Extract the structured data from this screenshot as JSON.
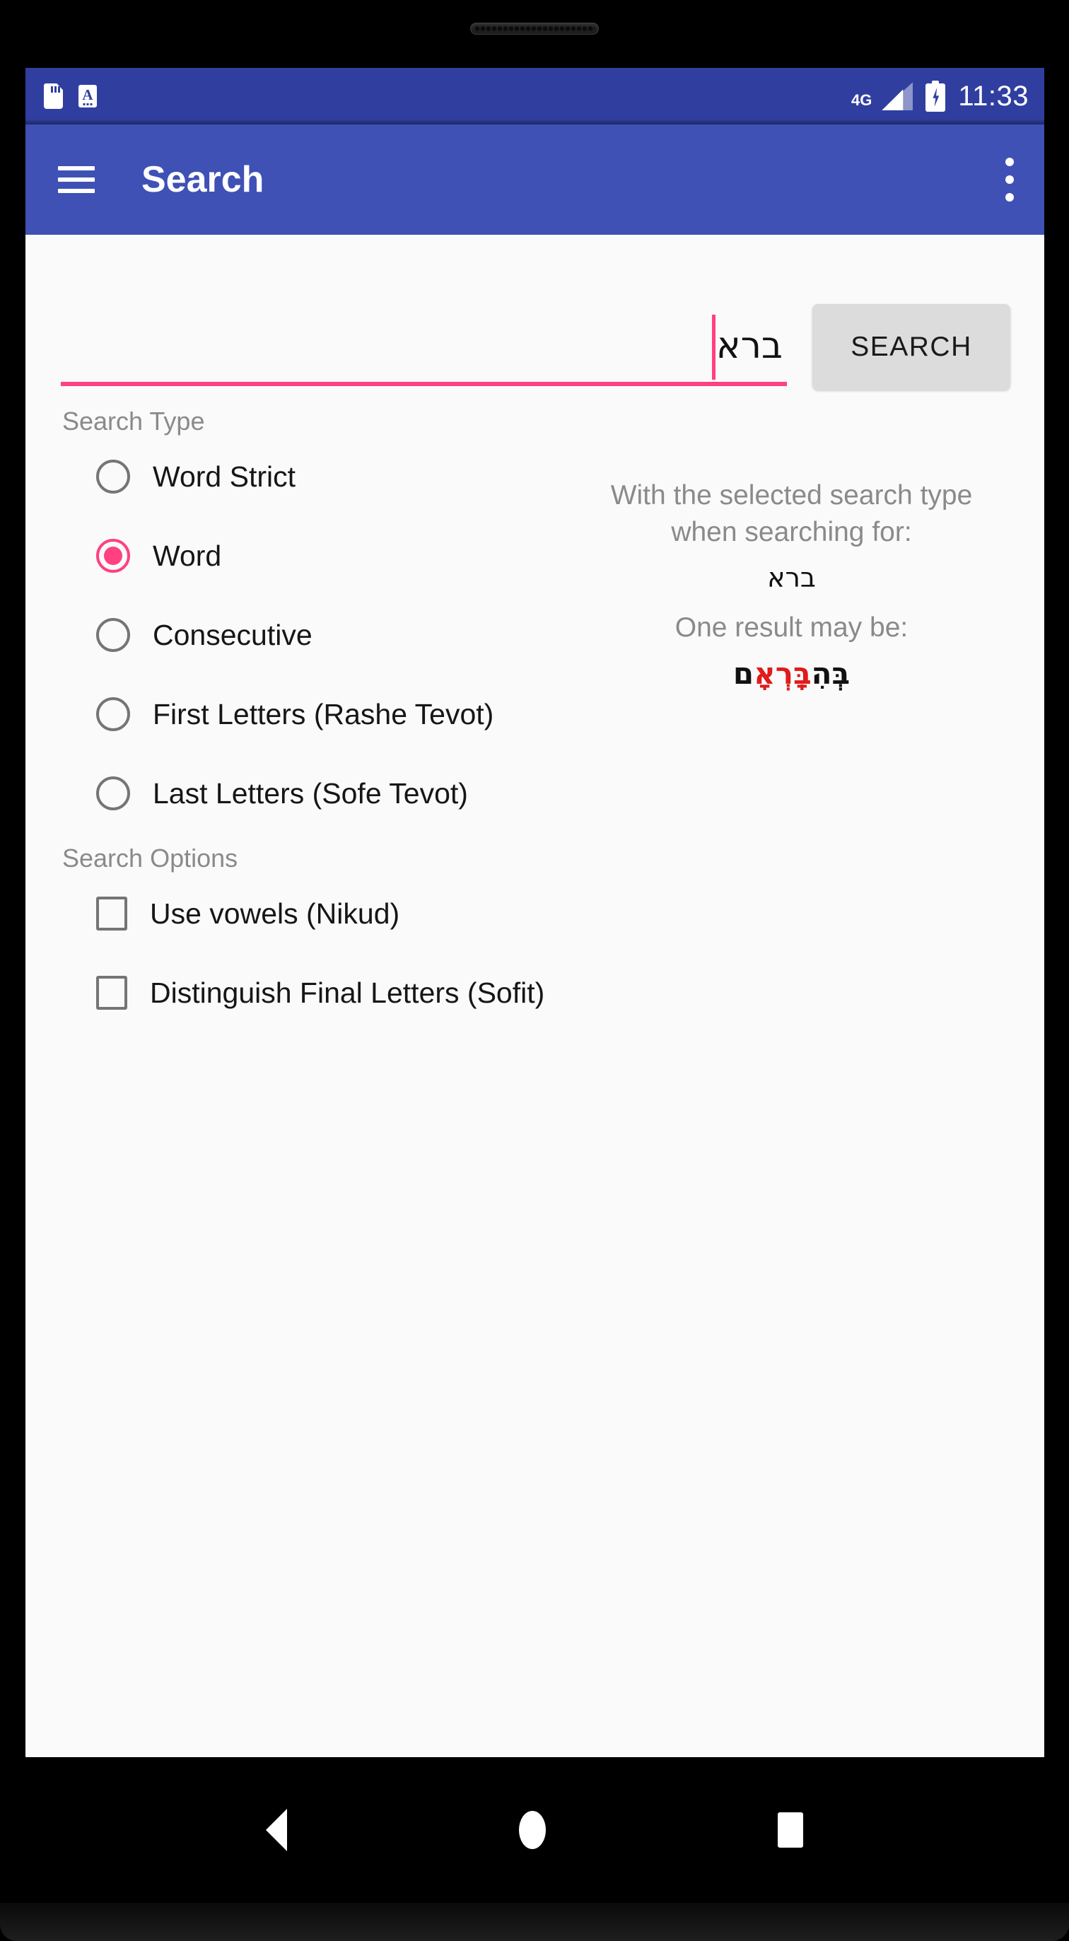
{
  "status_bar": {
    "icons": [
      "sdcard-icon",
      "keyboard-icon"
    ],
    "network_type": "4G",
    "clock": "11:33",
    "background_color": "#303F9F"
  },
  "app_bar": {
    "menu_icon": "hamburger-menu-icon",
    "title": "Search",
    "overflow_icon": "overflow-menu-icon",
    "background_color": "#3F51B5"
  },
  "search": {
    "input_value": "ברא",
    "placeholder": "",
    "button_label": "SEARCH",
    "underline_color": "#FF4081",
    "caret_color": "#FF4081"
  },
  "search_type": {
    "label": "Search Type",
    "selected": "Word",
    "options": [
      {
        "label": "Word Strict",
        "checked": false
      },
      {
        "label": "Word",
        "checked": true
      },
      {
        "label": "Consecutive",
        "checked": false
      },
      {
        "label": "First Letters (Rashe Tevot)",
        "checked": false
      },
      {
        "label": "Last Letters (Sofe Tevot)",
        "checked": false
      }
    ]
  },
  "search_options": {
    "label": "Search Options",
    "options": [
      {
        "label": "Use vowels (Nikud)",
        "checked": false
      },
      {
        "label": "Distinguish Final Letters (Sofit)",
        "checked": false
      }
    ]
  },
  "info_panel": {
    "line1": "With the selected search type",
    "line2": "when searching for:",
    "query_hebrew": "ברא",
    "line3": "One result may be:",
    "result_segments": [
      {
        "text": "בְּהִ",
        "highlight": false
      },
      {
        "text": "בָּֽרְאָ",
        "highlight": true
      },
      {
        "text": "ם",
        "highlight": false
      }
    ],
    "result_full": "בְּהִבָּֽרְאָם",
    "highlight_color": "#E01B1B",
    "text_color": "#8A8A8A"
  },
  "nav_bar": {
    "back_icon": "back-triangle-icon",
    "home_icon": "home-circle-icon",
    "recents_icon": "recents-square-icon"
  }
}
